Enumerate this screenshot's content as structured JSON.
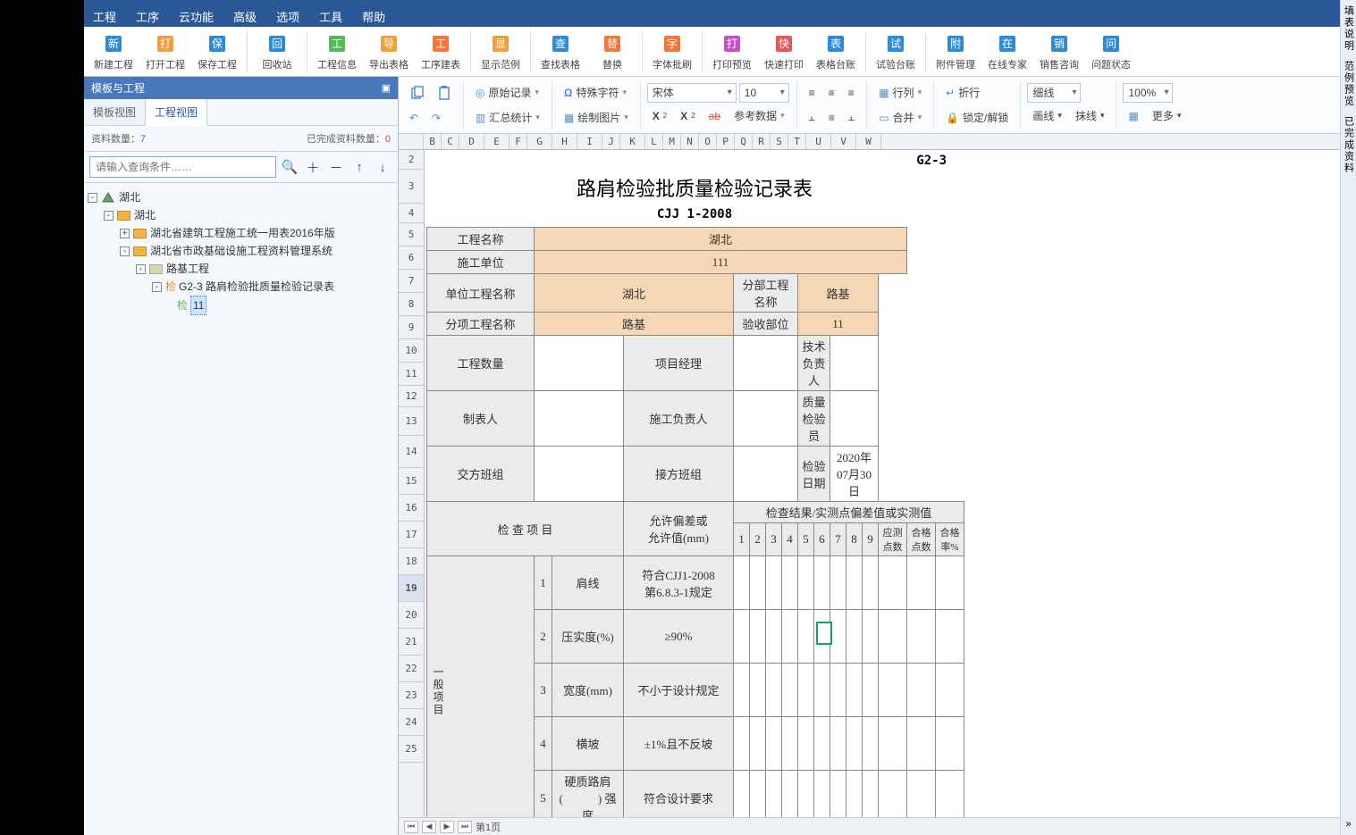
{
  "menu": {
    "items": [
      "工程",
      "工序",
      "云功能",
      "高级",
      "选项",
      "工具",
      "帮助"
    ]
  },
  "ribbon": [
    {
      "label": "新建工程",
      "color": "#2e8bd6",
      "icon": "file"
    },
    {
      "label": "打开工程",
      "color": "#f0a03a",
      "icon": "folder"
    },
    {
      "label": "保存工程",
      "color": "#2e8bd6",
      "icon": "save"
    },
    {
      "label": "回收站",
      "color": "#2e8bd6",
      "icon": "trash"
    },
    {
      "label": "工程信息",
      "color": "#58b758",
      "icon": "info"
    },
    {
      "label": "导出表格",
      "color": "#f0a03a",
      "icon": "export"
    },
    {
      "label": "工序建表",
      "color": "#f0763a",
      "icon": "table"
    },
    {
      "label": "显示范例",
      "color": "#f0a03a",
      "icon": "sample"
    },
    {
      "label": "查找表格",
      "color": "#2e8bd6",
      "icon": "search"
    },
    {
      "label": "替换",
      "color": "#f0763a",
      "icon": "replace"
    },
    {
      "label": "字体批刷",
      "color": "#f0763a",
      "icon": "brush"
    },
    {
      "label": "打印预览",
      "color": "#c452c4",
      "icon": "preview"
    },
    {
      "label": "快速打印",
      "color": "#e05858",
      "icon": "print"
    },
    {
      "label": "表格台账",
      "color": "#2e8bd6",
      "icon": "ledger1"
    },
    {
      "label": "试验台账",
      "color": "#2e8bd6",
      "icon": "ledger2"
    },
    {
      "label": "附件管理",
      "color": "#2e8bd6",
      "icon": "attach"
    },
    {
      "label": "在线专家",
      "color": "#2e8bd6",
      "icon": "expert"
    },
    {
      "label": "销售咨询",
      "color": "#2e8bd6",
      "icon": "sales"
    },
    {
      "label": "问题状态",
      "color": "#2e8bd6",
      "icon": "issue"
    }
  ],
  "side": {
    "title": "模板与工程",
    "tabs": [
      "模板视图",
      "工程视图"
    ],
    "active_tab": 1,
    "count_label": "资料数量：",
    "count": "7",
    "done_label": "已完成资料数量：",
    "done": "0",
    "search_placeholder": "请输入查询条件……",
    "root": "湖北",
    "child": "湖北",
    "l1": "湖北省建筑工程施工统一用表2016年版",
    "l2": "湖北省市政基础设施工程资料管理系统",
    "l3": "路基工程",
    "l4": "G2-3 路肩检验批质量检验记录表",
    "l5pre": "检",
    "l5sel": "11"
  },
  "tb2": {
    "orig": "原始记录",
    "spec": "特殊字符",
    "font": "宋体",
    "size": "10",
    "stat": "汇总统计",
    "pic": "绘制图片",
    "sup": "X",
    "sub": "X",
    "ref": "参考数据",
    "col": "行列",
    "wrap": "折行",
    "border1": "细线",
    "zoom": "100%",
    "merge": "合并",
    "lock": "锁定/解锁",
    "border2": "画线",
    "border3": "抹线",
    "more": "更多"
  },
  "cols": [
    "",
    "B",
    "C",
    "D",
    "E",
    "F",
    "G",
    "H",
    "I",
    "J",
    "K",
    "L",
    "M",
    "N",
    "O",
    "P",
    "Q",
    "R",
    "S",
    "T",
    "U",
    "V",
    "W"
  ],
  "rows": [
    2,
    3,
    4,
    5,
    6,
    7,
    8,
    9,
    10,
    11,
    12,
    13,
    14,
    15,
    16,
    17,
    18,
    19,
    20,
    21,
    22,
    23,
    24,
    25
  ],
  "form": {
    "code": "G2-3",
    "title": "路肩检验批质量检验记录表",
    "std": "CJJ 1-2008",
    "f1": "工程名称",
    "v1": "湖北",
    "f2": "施工单位",
    "v2": "111",
    "f3": "单位工程名称",
    "v3": "湖北",
    "f3b": "分部工程名称",
    "v3b": "路基",
    "f4": "分项工程名称",
    "v4": "路基",
    "f4b": "验收部位",
    "v4b": "11",
    "f5": "工程数量",
    "f5b": "项目经理",
    "f5c": "技术负责人",
    "f6": "制表人",
    "f6b": "施工负责人",
    "f6c": "质量检验员",
    "f7": "交方班组",
    "f7b": "接方班组",
    "f7c": "检验日期",
    "v7c": "2020年07月30日",
    "chk_header": "检 查 项 目",
    "tol_header": "允许偏差或\n允许值(mm)",
    "res_header": "检查结果/实测点偏差值或实测值",
    "nums": [
      "1",
      "2",
      "3",
      "4",
      "5",
      "6",
      "7",
      "8",
      "9"
    ],
    "cnt1": "应测\n点数",
    "cnt2": "合格\n点数",
    "cnt3": "合格\n率%",
    "cat": "一般项目",
    "rows": [
      {
        "n": "1",
        "name": "肩线",
        "tol": "符合CJJ1-2008\n第6.8.3-1规定"
      },
      {
        "n": "2",
        "name": "压实度(%)",
        "tol": "≥90%"
      },
      {
        "n": "3",
        "name": "宽度(mm)",
        "tol": "不小于设计规定"
      },
      {
        "n": "4",
        "name": "横坡",
        "tol": "±1%且不反坡"
      },
      {
        "n": "5",
        "name": "硬质路肩\n(　　　) 强度",
        "tol": "符合设计要求"
      }
    ]
  },
  "pager": {
    "page": "第1页"
  },
  "rtabs": [
    "填表说明",
    "范例预览",
    "已完成资料"
  ]
}
